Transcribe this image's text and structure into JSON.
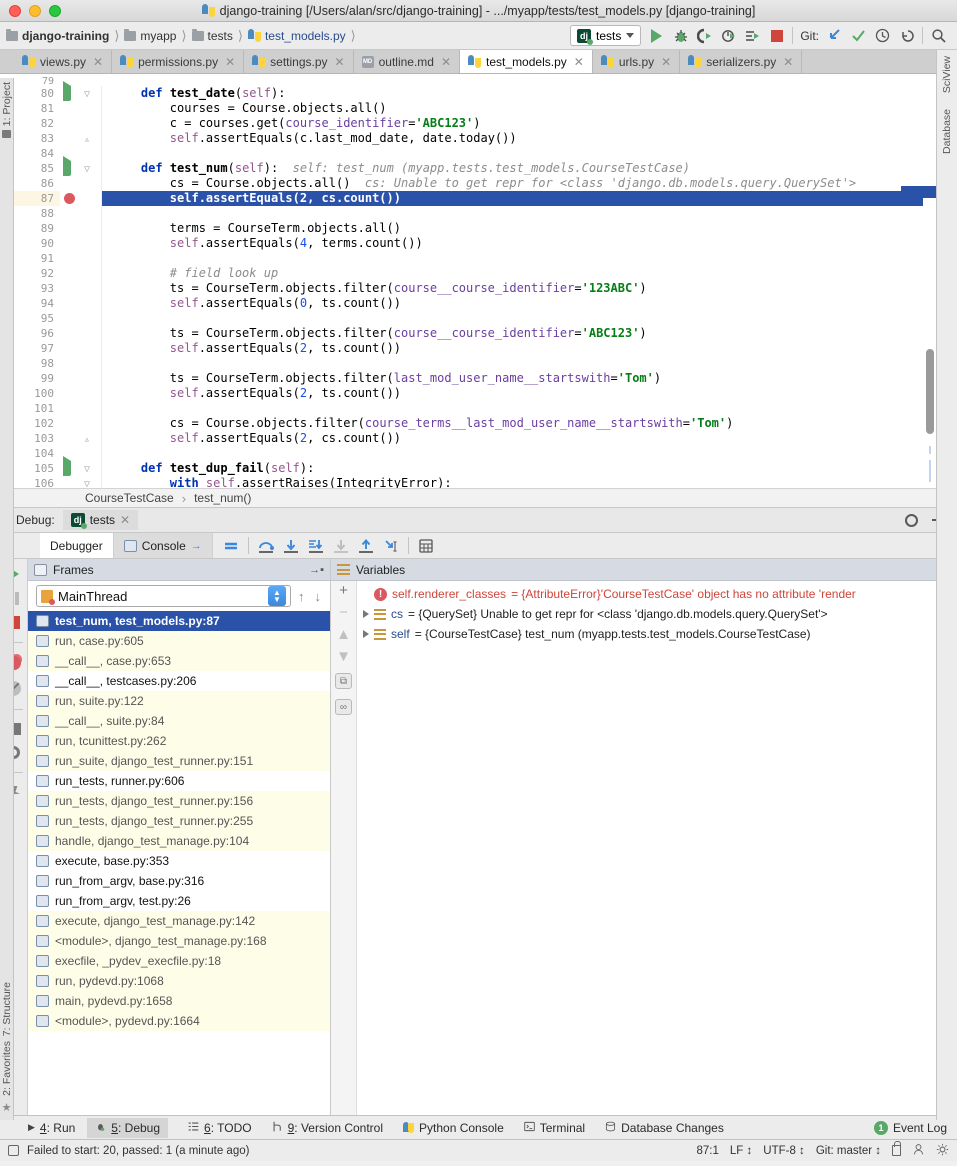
{
  "window": {
    "title": "django-training [/Users/alan/src/django-training] - .../myapp/tests/test_models.py [django-training]",
    "traffic": [
      "close",
      "minimize",
      "maximize"
    ]
  },
  "navbar": {
    "breadcrumbs": [
      {
        "label": "django-training",
        "icon": "folder-icon",
        "style": "bold"
      },
      {
        "label": "myapp",
        "icon": "folder-icon",
        "style": "normal"
      },
      {
        "label": "tests",
        "icon": "folder-icon",
        "style": "normal"
      },
      {
        "label": "test_models.py",
        "icon": "python-file-icon",
        "style": "link"
      }
    ],
    "run_config": {
      "label": "tests",
      "icon": "django-icon"
    },
    "buttons": [
      {
        "name": "run-button",
        "icon": "play-icon"
      },
      {
        "name": "debug-button",
        "icon": "bug-icon"
      },
      {
        "name": "run-coverage-button",
        "icon": "coverage-icon"
      },
      {
        "name": "profile-button",
        "icon": "profile-icon"
      },
      {
        "name": "run-with-console-button",
        "icon": "console-run-icon"
      },
      {
        "name": "stop-button",
        "icon": "stop-icon"
      }
    ],
    "git_label": "Git:",
    "git_buttons": [
      {
        "name": "update-project-button",
        "icon": "update-arrow-icon"
      },
      {
        "name": "commit-button",
        "icon": "checkmark-icon"
      },
      {
        "name": "history-button",
        "icon": "clock-icon"
      },
      {
        "name": "rollback-button",
        "icon": "undo-icon"
      }
    ],
    "search_button": {
      "name": "search-everywhere-button",
      "icon": "search-icon"
    }
  },
  "editor_tabs": [
    {
      "label": "views.py",
      "icon": "python-file-icon",
      "active": false
    },
    {
      "label": "permissions.py",
      "icon": "python-file-icon",
      "active": false
    },
    {
      "label": "settings.py",
      "icon": "python-file-icon",
      "active": false
    },
    {
      "label": "outline.md",
      "icon": "markdown-file-icon",
      "active": false
    },
    {
      "label": "test_models.py",
      "icon": "python-file-icon",
      "active": true
    },
    {
      "label": "urls.py",
      "icon": "python-file-icon",
      "active": false
    },
    {
      "label": "serializers.py",
      "icon": "python-file-icon",
      "active": false
    }
  ],
  "editor": {
    "partial_top_line": "79",
    "lines": [
      {
        "num": "80",
        "gutter": "run",
        "fold": "open",
        "indent": 2,
        "tokens": [
          {
            "t": "def ",
            "c": "kw"
          },
          {
            "t": "test_date",
            "c": "fn"
          },
          {
            "t": "(",
            "c": ""
          },
          {
            "t": "self",
            "c": "self"
          },
          {
            "t": "):",
            "c": ""
          }
        ]
      },
      {
        "num": "81",
        "indent": 3,
        "tokens": [
          {
            "t": "courses = Course.objects.all()",
            "c": ""
          }
        ]
      },
      {
        "num": "82",
        "indent": 3,
        "tokens": [
          {
            "t": "c = courses.get(",
            "c": ""
          },
          {
            "t": "course_identifier",
            "c": "param"
          },
          {
            "t": "=",
            "c": ""
          },
          {
            "t": "'ABC123'",
            "c": "str"
          },
          {
            "t": ")",
            "c": ""
          }
        ]
      },
      {
        "num": "83",
        "fold": "close",
        "indent": 3,
        "tokens": [
          {
            "t": "self",
            "c": "self"
          },
          {
            "t": ".assertEquals(c.last_mod_date, date.today())",
            "c": ""
          }
        ]
      },
      {
        "num": "84",
        "indent": 0,
        "tokens": []
      },
      {
        "num": "85",
        "gutter": "run",
        "fold": "open",
        "indent": 2,
        "tokens": [
          {
            "t": "def ",
            "c": "kw"
          },
          {
            "t": "test_num",
            "c": "fn"
          },
          {
            "t": "(",
            "c": ""
          },
          {
            "t": "self",
            "c": "self"
          },
          {
            "t": "):",
            "c": ""
          },
          {
            "t": "  self: test_num (myapp.tests.test_models.CourseTestCase)",
            "c": "hint"
          }
        ]
      },
      {
        "num": "86",
        "indent": 3,
        "tokens": [
          {
            "t": "cs = Course.objects.all()",
            "c": ""
          },
          {
            "t": "  cs: Unable to get repr for <class 'django.db.models.query.QuerySet'>",
            "c": "hint"
          }
        ]
      },
      {
        "num": "87",
        "gutter": "breakpoint",
        "highlight": true,
        "indent": 3,
        "tokens": [
          {
            "t": "self.assertEquals(2, cs.count())",
            "c": ""
          }
        ]
      },
      {
        "num": "88",
        "indent": 0,
        "tokens": []
      },
      {
        "num": "89",
        "indent": 3,
        "tokens": [
          {
            "t": "terms = CourseTerm.objects.all()",
            "c": ""
          }
        ]
      },
      {
        "num": "90",
        "indent": 3,
        "tokens": [
          {
            "t": "self",
            "c": "self"
          },
          {
            "t": ".assertEquals(",
            "c": ""
          },
          {
            "t": "4",
            "c": "num"
          },
          {
            "t": ", terms.count())",
            "c": ""
          }
        ]
      },
      {
        "num": "91",
        "indent": 0,
        "tokens": []
      },
      {
        "num": "92",
        "indent": 3,
        "tokens": [
          {
            "t": "# field look up",
            "c": "cmt"
          }
        ]
      },
      {
        "num": "93",
        "indent": 3,
        "tokens": [
          {
            "t": "ts = CourseTerm.objects.filter(",
            "c": ""
          },
          {
            "t": "course__course_identifier",
            "c": "param"
          },
          {
            "t": "=",
            "c": ""
          },
          {
            "t": "'123ABC'",
            "c": "str"
          },
          {
            "t": ")",
            "c": ""
          }
        ]
      },
      {
        "num": "94",
        "indent": 3,
        "tokens": [
          {
            "t": "self",
            "c": "self"
          },
          {
            "t": ".assertEquals(",
            "c": ""
          },
          {
            "t": "0",
            "c": "num"
          },
          {
            "t": ", ts.count())",
            "c": ""
          }
        ]
      },
      {
        "num": "95",
        "indent": 0,
        "tokens": []
      },
      {
        "num": "96",
        "indent": 3,
        "tokens": [
          {
            "t": "ts = CourseTerm.objects.filter(",
            "c": ""
          },
          {
            "t": "course__course_identifier",
            "c": "param"
          },
          {
            "t": "=",
            "c": ""
          },
          {
            "t": "'ABC123'",
            "c": "str"
          },
          {
            "t": ")",
            "c": ""
          }
        ]
      },
      {
        "num": "97",
        "indent": 3,
        "tokens": [
          {
            "t": "self",
            "c": "self"
          },
          {
            "t": ".assertEquals(",
            "c": ""
          },
          {
            "t": "2",
            "c": "num"
          },
          {
            "t": ", ts.count())",
            "c": ""
          }
        ]
      },
      {
        "num": "98",
        "indent": 0,
        "tokens": []
      },
      {
        "num": "99",
        "indent": 3,
        "tokens": [
          {
            "t": "ts = CourseTerm.objects.filter(",
            "c": ""
          },
          {
            "t": "last_mod_user_name__startswith",
            "c": "param"
          },
          {
            "t": "=",
            "c": ""
          },
          {
            "t": "'Tom'",
            "c": "str"
          },
          {
            "t": ")",
            "c": ""
          }
        ]
      },
      {
        "num": "100",
        "indent": 3,
        "tokens": [
          {
            "t": "self",
            "c": "self"
          },
          {
            "t": ".assertEquals(",
            "c": ""
          },
          {
            "t": "2",
            "c": "num"
          },
          {
            "t": ", ts.count())",
            "c": ""
          }
        ]
      },
      {
        "num": "101",
        "indent": 0,
        "tokens": []
      },
      {
        "num": "102",
        "indent": 3,
        "tokens": [
          {
            "t": "cs = Course.objects.filter(",
            "c": ""
          },
          {
            "t": "course_terms__last_mod_user_name__startswith",
            "c": "param"
          },
          {
            "t": "=",
            "c": ""
          },
          {
            "t": "'Tom'",
            "c": "str"
          },
          {
            "t": ")",
            "c": ""
          }
        ]
      },
      {
        "num": "103",
        "fold": "close",
        "indent": 3,
        "tokens": [
          {
            "t": "self",
            "c": "self"
          },
          {
            "t": ".assertEquals(",
            "c": ""
          },
          {
            "t": "2",
            "c": "num"
          },
          {
            "t": ", cs.count())",
            "c": ""
          }
        ]
      },
      {
        "num": "104",
        "indent": 0,
        "tokens": []
      },
      {
        "num": "105",
        "gutter": "run",
        "fold": "open",
        "indent": 2,
        "tokens": [
          {
            "t": "def ",
            "c": "kw"
          },
          {
            "t": "test_dup_fail",
            "c": "fn"
          },
          {
            "t": "(",
            "c": ""
          },
          {
            "t": "self",
            "c": "self"
          },
          {
            "t": "):",
            "c": ""
          }
        ]
      },
      {
        "num": "106",
        "fold": "open",
        "indent": 3,
        "tokens": [
          {
            "t": "with ",
            "c": "kw"
          },
          {
            "t": "self",
            "c": "self"
          },
          {
            "t": ".assertRaises(IntegrityError):",
            "c": ""
          }
        ]
      }
    ],
    "breadcrumb": {
      "class_name": "CourseTestCase",
      "method_name": "test_num()"
    }
  },
  "left_rail": {
    "top": "1: Project",
    "bottom_1": "7: Structure",
    "bottom_2": "2: Favorites"
  },
  "right_rail": {
    "item_1": "SciView",
    "item_2": "Database"
  },
  "debug_panel": {
    "header_label": "Debug:",
    "session_tab": "tests",
    "tabs": [
      {
        "label": "Debugger",
        "icon": "debugger-icon",
        "active": true
      },
      {
        "label": "Console",
        "icon": "console-icon",
        "active": false
      }
    ],
    "toolbar_buttons": [
      {
        "name": "rerun-button",
        "icon": "rerun-icon"
      },
      {
        "name": "show-execution-point-button",
        "icon": "execution-point-icon"
      },
      {
        "name": "step-over-button",
        "icon": "step-over-icon"
      },
      {
        "name": "step-into-button",
        "icon": "step-into-icon"
      },
      {
        "name": "force-step-into-button",
        "icon": "force-step-into-icon"
      },
      {
        "name": "step-out-button",
        "icon": "step-out-icon"
      },
      {
        "name": "run-to-cursor-button",
        "icon": "run-to-cursor-icon"
      },
      {
        "name": "evaluate-expression-button",
        "icon": "calculator-icon"
      }
    ],
    "side_buttons": [
      {
        "name": "resume-program-button",
        "icon": "resume-icon"
      },
      {
        "name": "pause-program-button",
        "icon": "pause-icon"
      },
      {
        "name": "stop-button",
        "icon": "stop-icon"
      },
      {
        "name": "view-breakpoints-button",
        "icon": "breakpoints-icon"
      },
      {
        "name": "mute-breakpoints-button",
        "icon": "mute-breakpoints-icon"
      },
      {
        "name": "layout-settings-button",
        "icon": "layout-icon"
      },
      {
        "name": "settings-button",
        "icon": "gear-icon"
      },
      {
        "name": "pin-tab-button",
        "icon": "pin-icon"
      }
    ],
    "frames": {
      "title": "Frames",
      "thread": "MainThread",
      "items": [
        {
          "label": "test_num, test_models.py:87",
          "kind": "selected"
        },
        {
          "label": "run, case.py:605",
          "kind": "library"
        },
        {
          "label": "__call__, case.py:653",
          "kind": "library"
        },
        {
          "label": "__call__, testcases.py:206",
          "kind": "user"
        },
        {
          "label": "run, suite.py:122",
          "kind": "library"
        },
        {
          "label": "__call__, suite.py:84",
          "kind": "library"
        },
        {
          "label": "run, tcunittest.py:262",
          "kind": "library"
        },
        {
          "label": "run_suite, django_test_runner.py:151",
          "kind": "library"
        },
        {
          "label": "run_tests, runner.py:606",
          "kind": "user"
        },
        {
          "label": "run_tests, django_test_runner.py:156",
          "kind": "library"
        },
        {
          "label": "run_tests, django_test_runner.py:255",
          "kind": "library"
        },
        {
          "label": "handle, django_test_manage.py:104",
          "kind": "library"
        },
        {
          "label": "execute, base.py:353",
          "kind": "user"
        },
        {
          "label": "run_from_argv, base.py:316",
          "kind": "user"
        },
        {
          "label": "run_from_argv, test.py:26",
          "kind": "user"
        },
        {
          "label": "execute, django_test_manage.py:142",
          "kind": "library"
        },
        {
          "label": "<module>, django_test_manage.py:168",
          "kind": "library"
        },
        {
          "label": "execfile, _pydev_execfile.py:18",
          "kind": "library"
        },
        {
          "label": "run, pydevd.py:1068",
          "kind": "library"
        },
        {
          "label": "main, pydevd.py:1658",
          "kind": "library"
        },
        {
          "label": "<module>, pydevd.py:1664",
          "kind": "library"
        }
      ]
    },
    "variables": {
      "title": "Variables",
      "rows": [
        {
          "icon": "error-icon",
          "expandable": false,
          "name": "self.renderer_classes",
          "value": "= {AttributeError}'CourseTestCase' object has no attribute 'render",
          "error": true
        },
        {
          "icon": "variable-icon",
          "expandable": true,
          "name": "cs",
          "value": "= {QuerySet} Unable to get repr for <class 'django.db.models.query.QuerySet'>",
          "error": false
        },
        {
          "icon": "variable-icon",
          "expandable": true,
          "name": "self",
          "value": "= {CourseTestCase} test_num (myapp.tests.test_models.CourseTestCase)",
          "error": false
        }
      ],
      "rail_buttons": [
        {
          "name": "add-watch-button",
          "label": "+"
        },
        {
          "name": "remove-watch-button",
          "label": "−"
        },
        {
          "name": "move-up-button",
          "label": "▲"
        },
        {
          "name": "move-down-button",
          "label": "▼"
        },
        {
          "name": "copy-value-button",
          "label": "❐"
        },
        {
          "name": "inline-watches-button",
          "label": "∞"
        }
      ]
    }
  },
  "toolwindow_bar": {
    "items": [
      {
        "num": "4",
        "label": ": Run",
        "icon": "play-icon",
        "active": false
      },
      {
        "num": "5",
        "label": ": Debug",
        "icon": "bug-icon",
        "active": true
      },
      {
        "num": "6",
        "label": ": TODO",
        "icon": "todo-icon",
        "active": false
      },
      {
        "num": "9",
        "label": ": Version Control",
        "icon": "branch-icon",
        "active": false
      },
      {
        "num": "",
        "label": "Python Console",
        "icon": "python-console-icon",
        "active": false
      },
      {
        "num": "",
        "label": "Terminal",
        "icon": "terminal-icon",
        "active": false
      },
      {
        "num": "",
        "label": "Database Changes",
        "icon": "database-changes-icon",
        "active": false
      }
    ],
    "event_log": "Event Log"
  },
  "status_bar": {
    "message": "Failed to start: 20, passed: 1 (a minute ago)",
    "caret": "87:1",
    "line_sep": "LF",
    "encoding": "UTF-8",
    "branch": "Git: master",
    "icons": [
      "lock-icon",
      "hippie-icon",
      "inspection-icon"
    ]
  },
  "colors": {
    "selection_blue": "#2a52a8",
    "library_frame_bg": "#fefde8",
    "breakpoint_red": "#db5860",
    "string_green": "#067d17",
    "keyword_blue": "#0033b3",
    "self_purple": "#94558d",
    "link_blue": "#2a4b8d",
    "error_red": "#d0453b",
    "run_green": "#59a869"
  }
}
